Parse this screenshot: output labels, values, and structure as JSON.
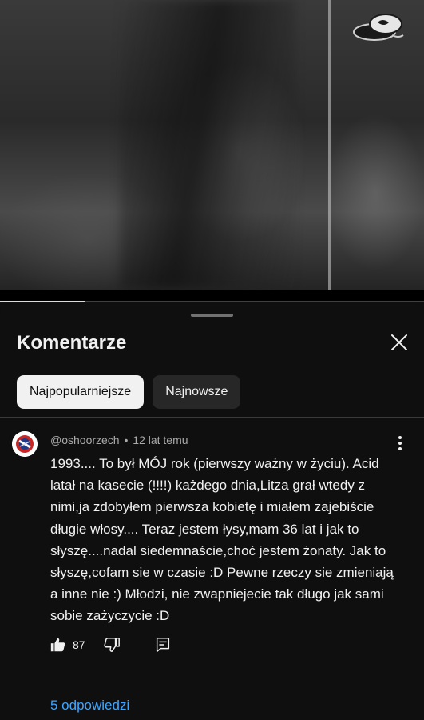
{
  "video": {
    "progress": 0.2
  },
  "comments_panel": {
    "title": "Komentarze",
    "close_icon": "close-icon",
    "sort_chips": [
      {
        "label": "Najpopularniejsze",
        "active": true
      },
      {
        "label": "Najnowsze",
        "active": false
      }
    ]
  },
  "comment": {
    "author": "@oshoorzech",
    "separator": "•",
    "time": "12 lat temu",
    "text": "1993.... To był MÓJ rok (pierwszy ważny w życiu). Acid latał na kasecie (!!!!) każdego dnia,Litza grał wtedy z nimi,ja zdobyłem pierwsza kobietę i miałem zajebiście długie włosy.... Teraz jestem łysy,mam 36 lat i jak to słyszę....nadal siedemnaście,choć jestem żonaty. Jak to słyszę,cofam sie w czasie :D Pewne rzeczy sie zmieniają a inne nie :) Młodzi, nie zwapniejecie tak długo jak sami sobie zażyczycie :D",
    "likes": "87",
    "replies_label": "5 odpowiedzi",
    "icons": {
      "like": "thumbs-up-icon",
      "dislike": "thumbs-down-icon",
      "reply": "reply-icon",
      "more": "more-vert-icon"
    }
  },
  "colors": {
    "background": "#0f0f0f",
    "link": "#3ea6ff",
    "chip_active_bg": "#f1f1f1",
    "chip_inactive_bg": "#272727"
  }
}
